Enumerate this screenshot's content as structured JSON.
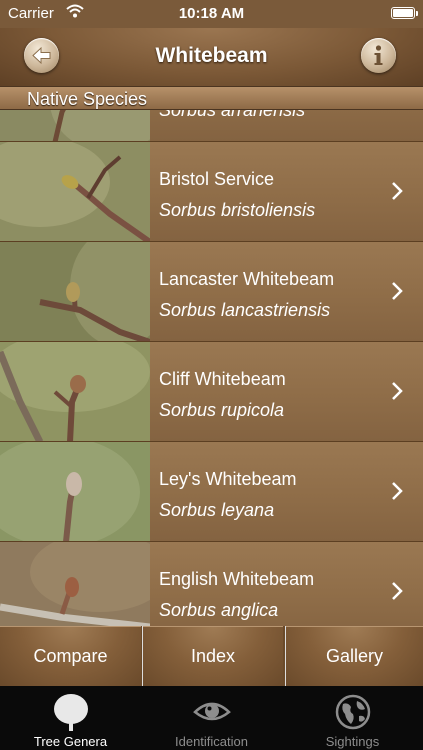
{
  "status": {
    "carrier": "Carrier",
    "time": "10:18 AM"
  },
  "nav": {
    "title": "Whitebeam"
  },
  "section": {
    "title": "Native Species"
  },
  "species": [
    {
      "common": "",
      "latin": "Sorbus arranensis"
    },
    {
      "common": "Bristol Service",
      "latin": "Sorbus bristoliensis"
    },
    {
      "common": "Lancaster Whitebeam",
      "latin": "Sorbus lancastriensis"
    },
    {
      "common": "Cliff Whitebeam",
      "latin": "Sorbus rupicola"
    },
    {
      "common": "Ley's Whitebeam",
      "latin": "Sorbus leyana"
    },
    {
      "common": "English Whitebeam",
      "latin": "Sorbus anglica"
    }
  ],
  "actions": {
    "compare": "Compare",
    "index": "Index",
    "gallery": "Gallery"
  },
  "tabs": [
    {
      "label": "Tree Genera",
      "icon": "tree-icon",
      "active": true
    },
    {
      "label": "Identification",
      "icon": "eye-icon",
      "active": false
    },
    {
      "label": "Sightings",
      "icon": "globe-icon",
      "active": false
    }
  ],
  "colors": {
    "nav_brown": "#7c5937",
    "row_brown": "#8f6d48",
    "tab_bg": "#0a0a0a"
  }
}
